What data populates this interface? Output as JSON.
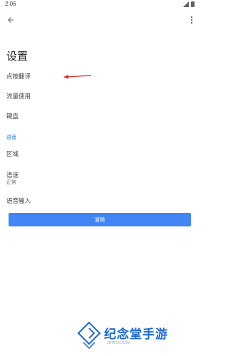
{
  "status_bar": {
    "time": "2:06"
  },
  "page": {
    "title": "设置"
  },
  "items": [
    {
      "label": "点按翻译"
    },
    {
      "label": "流量使用"
    },
    {
      "label": "键盘"
    }
  ],
  "section": {
    "header": "语音"
  },
  "voice_items": [
    {
      "label": "区域"
    },
    {
      "label": "语速",
      "value": "正常"
    },
    {
      "label": "语音输入"
    }
  ],
  "clear_button": {
    "label": "清除"
  },
  "watermark": {
    "text": "纪念堂手游",
    "sub": "JNTECC.COM"
  },
  "colors": {
    "accent": "#1a73e8",
    "button": "#4285f4",
    "arrow": "#d93025"
  }
}
